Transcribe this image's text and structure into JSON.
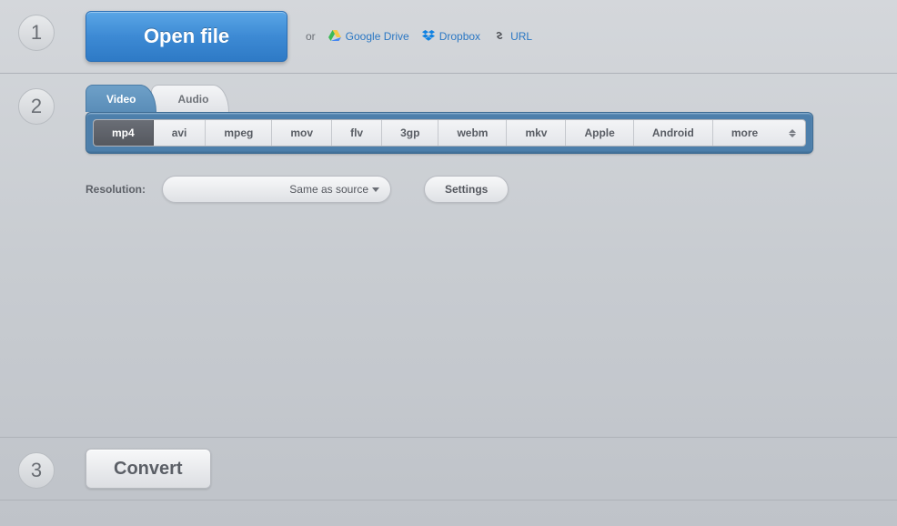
{
  "step1": {
    "num": "1",
    "open_label": "Open file",
    "or": "or",
    "sources": [
      {
        "name": "Google Drive",
        "icon": "drive"
      },
      {
        "name": "Dropbox",
        "icon": "dropbox"
      },
      {
        "name": "URL",
        "icon": "link"
      }
    ]
  },
  "step2": {
    "num": "2",
    "tabs": {
      "video": "Video",
      "audio": "Audio"
    },
    "formats": [
      "mp4",
      "avi",
      "mpeg",
      "mov",
      "flv",
      "3gp",
      "webm",
      "mkv",
      "Apple",
      "Android",
      "more"
    ],
    "selected_format": "mp4",
    "resolution_label": "Resolution:",
    "resolution_value": "Same as source",
    "settings_label": "Settings"
  },
  "step3": {
    "num": "3",
    "convert_label": "Convert"
  }
}
